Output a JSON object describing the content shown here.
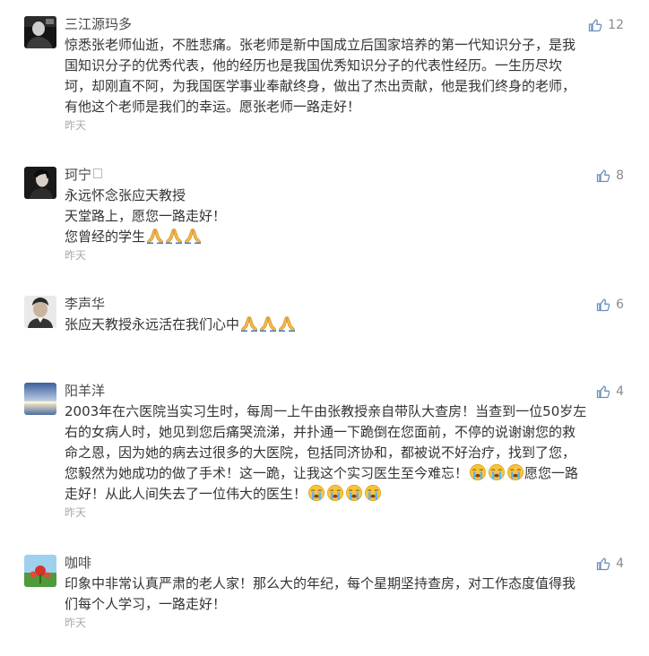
{
  "comments": [
    {
      "name": "三江源玛多",
      "likes": "12",
      "lines": [
        "惊悉张老师仙逝，不胜悲痛。张老师是新中国成立后国家培养的第一代知识分子，是我",
        "国知识分子的优秀代表，他的经历也是我国优秀知识分子的代表性经历。一生历尽坎",
        "坷，却刚直不阿，为我国医学事业奉献终身，做出了杰出贡献，他是我们终身的老师，",
        "有他这个老师是我们的幸运。愿张老师一路走好！"
      ],
      "time": "昨天"
    },
    {
      "name": "珂宁",
      "likes": "8",
      "lines": [
        "永远怀念张应天教授",
        "天堂路上，愿您一路走好！",
        "您曾经的学生"
      ],
      "time": "昨天"
    },
    {
      "name": "李声华",
      "likes": "6",
      "lines": [
        "张应天教授永远活在我们心中"
      ],
      "time": ""
    },
    {
      "name": "阳羊洋",
      "likes": "4",
      "lines": [
        "2003年在六医院当实习生时，每周一上午由张教授亲自带队大查房！当查到一位50岁左",
        "右的女病人时，她见到您后痛哭流涕，并扑通一下跪倒在您面前，不停的说谢谢您的救",
        "命之恩，因为她的病去过很多的大医院，包括同济协和，都被说不好治疗，找到了您，",
        "您毅然为她成功的做了手术！这一跪，让我这个实习医生至今难忘！",
        "走好！从此人间失去了一位伟大的医生！"
      ],
      "line4_tail": "愿您一路",
      "time": "昨天"
    },
    {
      "name": "咖啡",
      "likes": "4",
      "lines": [
        "印象中非常认真严肃的老人家！那么大的年纪，每个星期坚持查房，对工作态度值得我",
        "们每个人学习，一路走好！"
      ],
      "time": "昨天"
    }
  ],
  "icons": {
    "like": "thumbs-up-icon",
    "pray": "praying-hands-emoji",
    "cry": "crying-face-emoji"
  },
  "colors": {
    "name": "#4a4a4a",
    "text": "#333333",
    "meta": "#aaaaaa",
    "like_icon": "#6b8fbf"
  }
}
